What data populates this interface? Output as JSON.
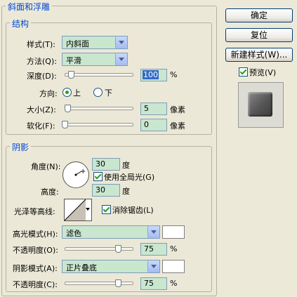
{
  "panel": {
    "title": "斜面和浮雕"
  },
  "structure": {
    "legend": "结构",
    "style_label": "样式(T):",
    "style_value": "内斜面",
    "technique_label": "方法(Q):",
    "technique_value": "平滑",
    "depth_label": "深度(D):",
    "depth_value": "100",
    "depth_unit": "%",
    "depth_level": 100,
    "direction_label": "方向:",
    "dir_up": "上",
    "dir_down": "下",
    "direction_selected": "上",
    "size_label": "大小(Z):",
    "size_value": "5",
    "size_unit": "像素",
    "size_level": 5,
    "soften_label": "软化(F):",
    "soften_value": "0",
    "soften_unit": "像素",
    "soften_level": 0
  },
  "shading": {
    "legend": "阴影",
    "angle_label": "角度(N):",
    "angle_value": "30",
    "angle_unit": "度",
    "global_light_label": "使用全局光(G)",
    "global_light_checked": true,
    "altitude_label": "高度:",
    "altitude_value": "30",
    "altitude_unit": "度",
    "gloss_label": "光泽等高线:",
    "antialias_label": "消除锯齿(L)",
    "antialias_checked": true,
    "highlight_mode_label": "高光模式(H):",
    "highlight_mode_value": "滤色",
    "highlight_color": "#ffffff",
    "highlight_opacity_label": "不透明度(O):",
    "highlight_opacity_value": "75",
    "highlight_opacity_unit": "%",
    "shadow_mode_label": "阴影模式(A):",
    "shadow_mode_value": "正片叠底",
    "shadow_color": "#ffffff",
    "shadow_opacity_label": "不透明度(C):",
    "shadow_opacity_value": "75",
    "shadow_opacity_unit": "%"
  },
  "buttons": {
    "ok": "确定",
    "reset": "复位",
    "new_style": "新建样式(W)...",
    "preview": "预览(V)",
    "preview_checked": true
  },
  "colors": {
    "accent": "#0046d5",
    "field": "#c9e6cf",
    "selection": "#316ac5"
  }
}
